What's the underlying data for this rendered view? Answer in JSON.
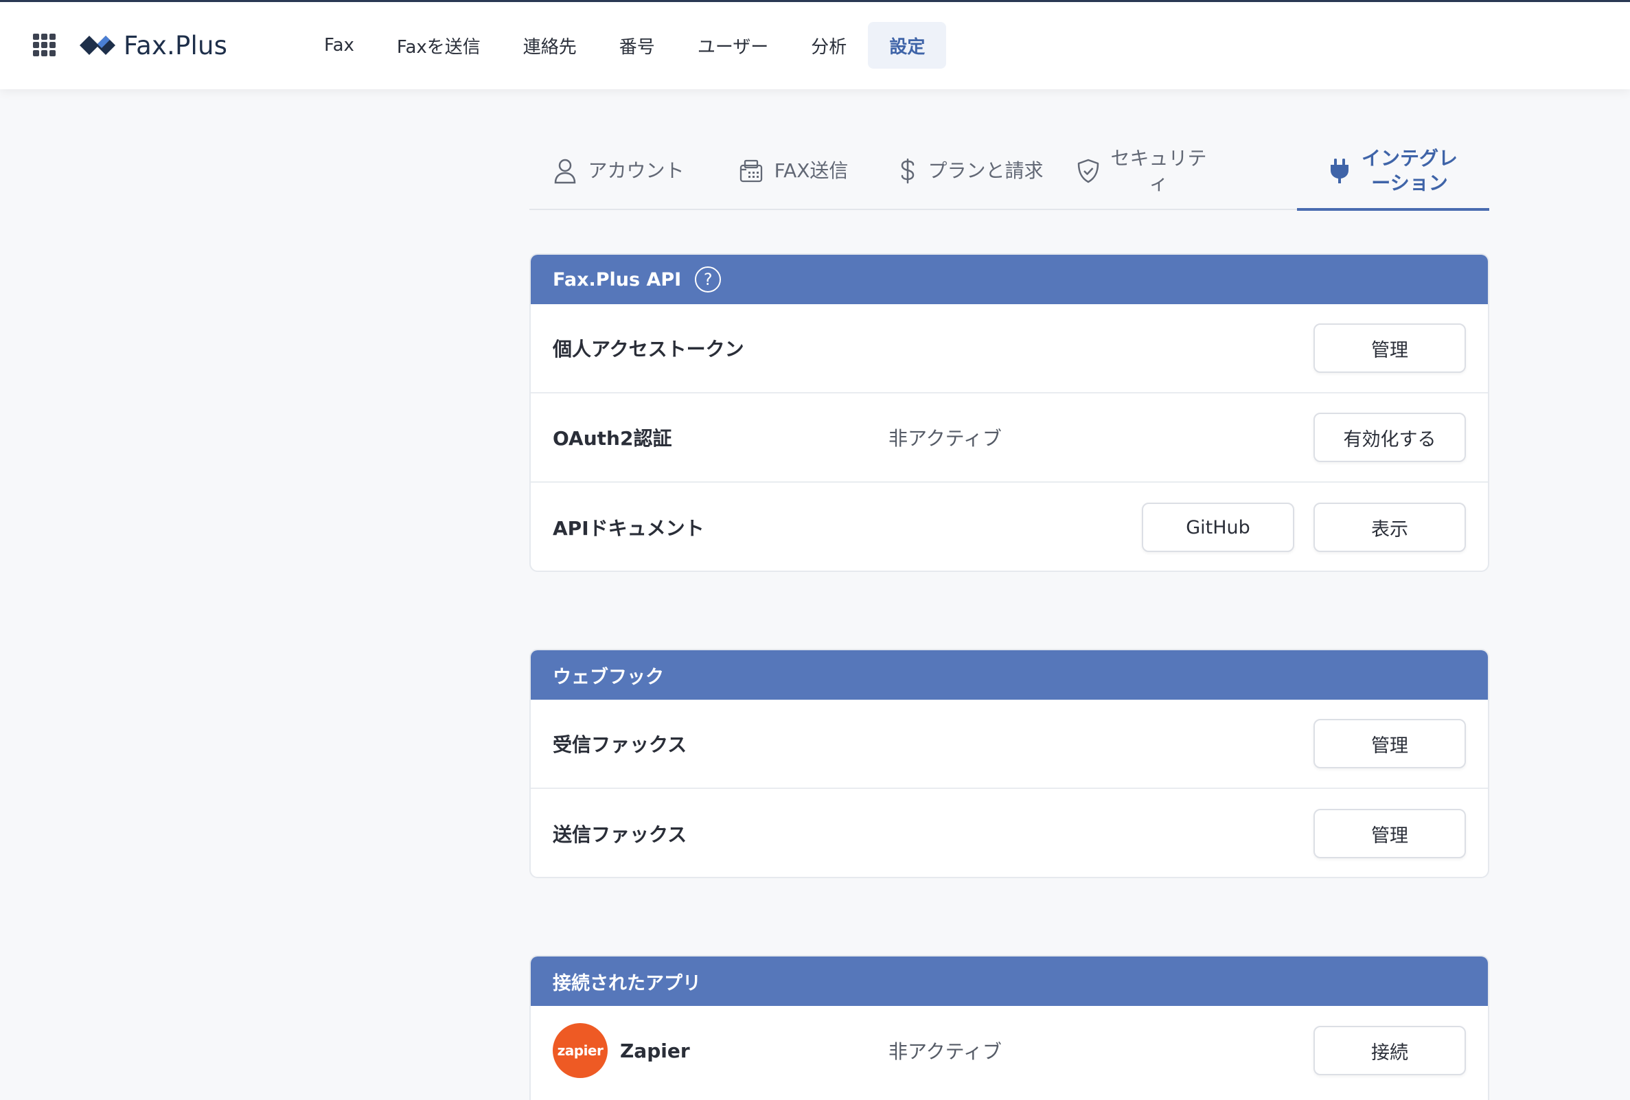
{
  "app": {
    "name": "Fax.Plus"
  },
  "nav": {
    "items": [
      {
        "label": "Fax"
      },
      {
        "label": "Faxを送信"
      },
      {
        "label": "連絡先"
      },
      {
        "label": "番号"
      },
      {
        "label": "ユーザー"
      },
      {
        "label": "分析"
      },
      {
        "label": "設定"
      }
    ],
    "active": "設定"
  },
  "tabs": {
    "items": [
      {
        "label": "アカウント",
        "icon": "user-icon"
      },
      {
        "label": "FAX送信",
        "icon": "fax-machine-icon"
      },
      {
        "label": "プランと請求",
        "icon": "dollar-icon"
      },
      {
        "label": "セキュリテ\nィ",
        "icon": "shield-check-icon"
      },
      {
        "label": "インテグレ\nーション",
        "icon": "plug-icon"
      }
    ],
    "active": "インテグレーション"
  },
  "api_card": {
    "title": "Fax.Plus API",
    "help": "?",
    "rows": [
      {
        "label": "個人アクセストークン",
        "button": "管理"
      },
      {
        "label": "OAuth2認証",
        "status": "非アクティブ",
        "button": "有効化する"
      },
      {
        "label": "APIドキュメント",
        "button_secondary": "GitHub",
        "button": "表示"
      }
    ]
  },
  "webhook_card": {
    "title": "ウェブフック",
    "rows": [
      {
        "label": "受信ファックス",
        "button": "管理"
      },
      {
        "label": "送信ファックス",
        "button": "管理"
      }
    ]
  },
  "apps_card": {
    "title": "接続されたアプリ",
    "rows": [
      {
        "logo_text": "zapier",
        "label": "Zapier",
        "status": "非アクティブ",
        "button": "接続"
      }
    ]
  },
  "colors": {
    "accent": "#5677ba",
    "active_text": "#3f64a8",
    "zapier": "#ee5a24"
  }
}
